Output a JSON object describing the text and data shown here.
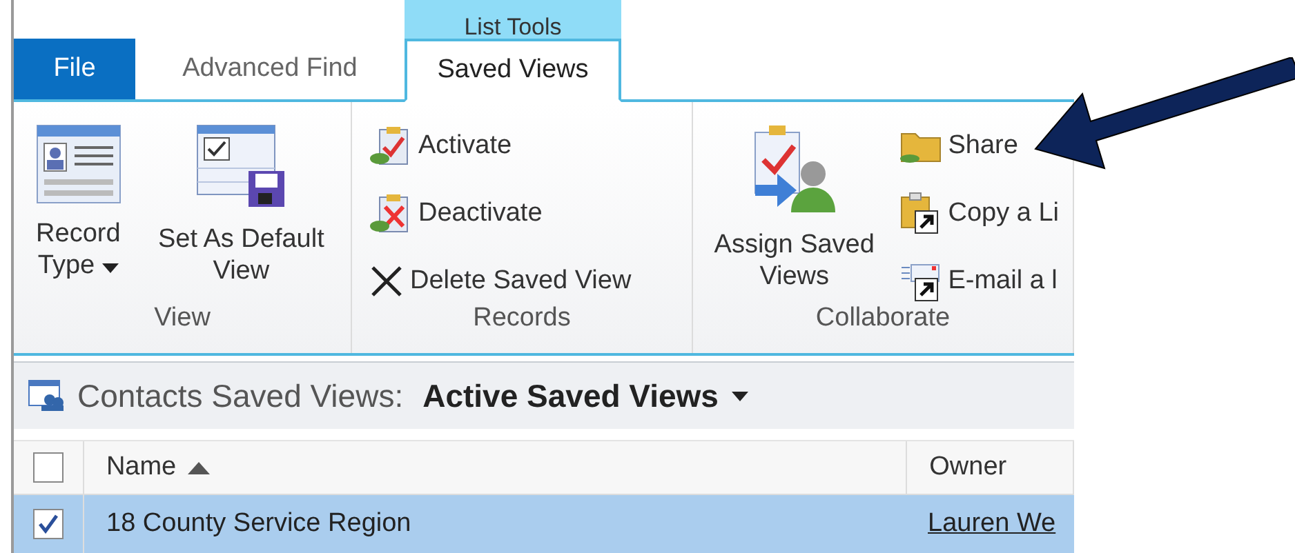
{
  "contextual_tab": {
    "label": "List Tools"
  },
  "tabs": [
    {
      "label": "File",
      "kind": "file",
      "selected": false
    },
    {
      "label": "Advanced Find",
      "kind": "tab",
      "selected": false
    },
    {
      "label": "Saved Views",
      "kind": "tab",
      "selected": true
    }
  ],
  "ribbon_groups": [
    {
      "label": "View",
      "buttons": [
        {
          "label": "Record Type",
          "kind": "large",
          "dropdown": true
        },
        {
          "label": "Set As Default View",
          "kind": "large",
          "dropdown": false
        }
      ]
    },
    {
      "label": "Records",
      "buttons": [
        {
          "label": "Activate",
          "kind": "small"
        },
        {
          "label": "Deactivate",
          "kind": "small"
        },
        {
          "label": "Delete Saved View",
          "kind": "small"
        }
      ]
    },
    {
      "label": "Collaborate",
      "buttons": [
        {
          "label": "Assign Saved Views",
          "kind": "large",
          "dropdown": false
        },
        {
          "label": "Share",
          "kind": "small"
        },
        {
          "label": "Copy a Li",
          "kind": "small"
        },
        {
          "label": "E-mail a l",
          "kind": "small"
        }
      ]
    }
  ],
  "grid": {
    "entity_label": "Contacts Saved Views:",
    "view_name": "Active Saved Views",
    "header_checked": false,
    "columns": [
      {
        "label": "Name",
        "sorted": true
      },
      {
        "label": "Owner",
        "sorted": false
      }
    ],
    "rows": [
      {
        "selected": true,
        "checked": true,
        "cells": [
          "18 County Service Region",
          "Lauren We"
        ]
      }
    ]
  }
}
